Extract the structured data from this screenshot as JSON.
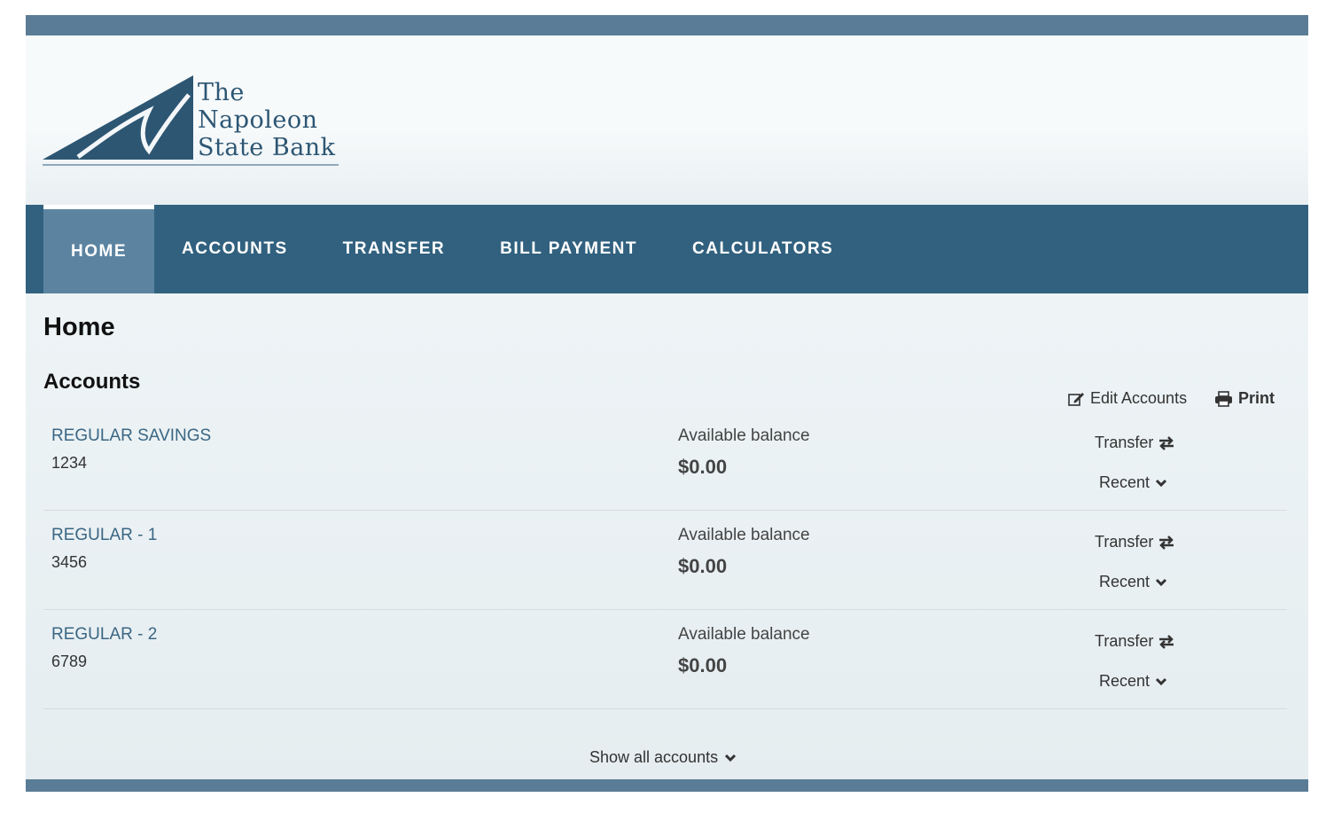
{
  "bank": {
    "logo_lines": [
      "The",
      "Napoleon",
      "State Bank"
    ],
    "brand_color": "#31617f"
  },
  "nav": {
    "items": [
      {
        "label": "HOME",
        "active": true
      },
      {
        "label": "ACCOUNTS",
        "active": false
      },
      {
        "label": "TRANSFER",
        "active": false
      },
      {
        "label": "BILL PAYMENT",
        "active": false
      },
      {
        "label": "CALCULATORS",
        "active": false
      }
    ]
  },
  "page": {
    "title": "Home",
    "section_title": "Accounts",
    "edit_label": "Edit Accounts",
    "print_label": "Print"
  },
  "accounts": [
    {
      "name": "REGULAR SAVINGS",
      "number": "1234",
      "balance_label": "Available balance",
      "balance": "$0.00",
      "transfer_label": "Transfer",
      "recent_label": "Recent"
    },
    {
      "name": "REGULAR - 1",
      "number": "3456",
      "balance_label": "Available balance",
      "balance": "$0.00",
      "transfer_label": "Transfer",
      "recent_label": "Recent"
    },
    {
      "name": "REGULAR - 2",
      "number": "6789",
      "balance_label": "Available balance",
      "balance": "$0.00",
      "transfer_label": "Transfer",
      "recent_label": "Recent"
    }
  ],
  "footer": {
    "show_all_label": "Show all accounts"
  },
  "icons": {
    "edit": "edit-icon",
    "print": "printer-icon",
    "transfer": "transfer-arrows-icon",
    "chevron": "chevron-down-icon"
  }
}
